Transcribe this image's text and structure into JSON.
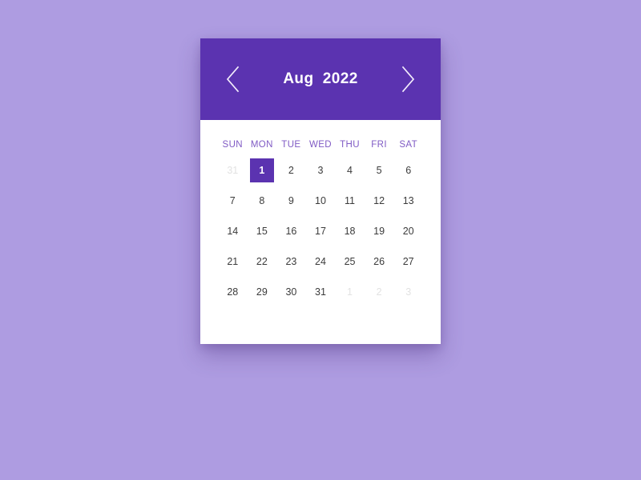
{
  "background_color": "#ae9ce1",
  "theme": {
    "accent": "#5b33b0",
    "weekday_label_color": "#7f5ac4",
    "day_color": "#3b3b3b",
    "muted_day_color": "#e2e2e2",
    "card_background": "#ffffff"
  },
  "header": {
    "title": "Aug  2022",
    "month": "Aug",
    "year": "2022",
    "prev_label": "Previous month",
    "next_label": "Next month",
    "prev_icon": "chevron-left-icon",
    "next_icon": "chevron-right-icon"
  },
  "weekdays": [
    "SUN",
    "MON",
    "TUE",
    "WED",
    "THU",
    "FRI",
    "SAT"
  ],
  "weeks": [
    [
      {
        "label": "31",
        "state": "muted"
      },
      {
        "label": "1",
        "state": "selected"
      },
      {
        "label": "2",
        "state": "normal"
      },
      {
        "label": "3",
        "state": "normal"
      },
      {
        "label": "4",
        "state": "normal"
      },
      {
        "label": "5",
        "state": "normal"
      },
      {
        "label": "6",
        "state": "normal"
      }
    ],
    [
      {
        "label": "7",
        "state": "normal"
      },
      {
        "label": "8",
        "state": "normal"
      },
      {
        "label": "9",
        "state": "normal"
      },
      {
        "label": "10",
        "state": "normal"
      },
      {
        "label": "11",
        "state": "normal"
      },
      {
        "label": "12",
        "state": "normal"
      },
      {
        "label": "13",
        "state": "normal"
      }
    ],
    [
      {
        "label": "14",
        "state": "normal"
      },
      {
        "label": "15",
        "state": "normal"
      },
      {
        "label": "16",
        "state": "normal"
      },
      {
        "label": "17",
        "state": "normal"
      },
      {
        "label": "18",
        "state": "normal"
      },
      {
        "label": "19",
        "state": "normal"
      },
      {
        "label": "20",
        "state": "normal"
      }
    ],
    [
      {
        "label": "21",
        "state": "normal"
      },
      {
        "label": "22",
        "state": "normal"
      },
      {
        "label": "23",
        "state": "normal"
      },
      {
        "label": "24",
        "state": "normal"
      },
      {
        "label": "25",
        "state": "normal"
      },
      {
        "label": "26",
        "state": "normal"
      },
      {
        "label": "27",
        "state": "normal"
      }
    ],
    [
      {
        "label": "28",
        "state": "normal"
      },
      {
        "label": "29",
        "state": "normal"
      },
      {
        "label": "30",
        "state": "normal"
      },
      {
        "label": "31",
        "state": "normal"
      },
      {
        "label": "1",
        "state": "muted"
      },
      {
        "label": "2",
        "state": "muted"
      },
      {
        "label": "3",
        "state": "muted"
      }
    ]
  ]
}
